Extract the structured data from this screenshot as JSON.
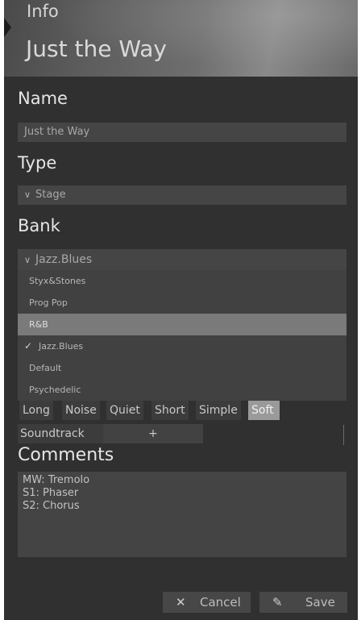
{
  "header": {
    "small_title": "Info",
    "preset_title": "Just the Way"
  },
  "name": {
    "label": "Name",
    "value": "Just the Way"
  },
  "type": {
    "label": "Type",
    "value": "Stage"
  },
  "bank": {
    "label": "Bank",
    "value": "Jazz.Blues",
    "options": [
      {
        "label": "Styx&Stones"
      },
      {
        "label": "Prog Pop"
      },
      {
        "label": "R&B"
      },
      {
        "label": "Jazz.Blues"
      },
      {
        "label": "Default"
      },
      {
        "label": "Psychedelic"
      }
    ],
    "highlighted_option": "R&B",
    "checked_option": "Jazz.Blues",
    "check_glyph": "✓"
  },
  "tags": {
    "row1": [
      {
        "label": "Long"
      },
      {
        "label": "Noise"
      },
      {
        "label": "Quiet"
      },
      {
        "label": "Short"
      },
      {
        "label": "Simple"
      },
      {
        "label": "Soft"
      }
    ],
    "active_tag": "Soft",
    "row2_tag": "Soundtrack",
    "add_label": "+"
  },
  "comments": {
    "label": "Comments",
    "text": "MW: Tremolo\nS1: Phaser\nS2: Chorus"
  },
  "footer": {
    "cancel_icon": "✕",
    "cancel_label": "Cancel",
    "save_icon": "✎",
    "save_label": "Save"
  },
  "colors": {
    "panel_bg": "#303030",
    "field_bg": "#454545",
    "highlight": "#7a7a7a",
    "active_tag_bg": "#9a9a9a"
  },
  "icons": {
    "chevron": "chevron-down-icon",
    "check": "check-icon",
    "cancel": "close-icon",
    "save": "pencil-icon"
  }
}
